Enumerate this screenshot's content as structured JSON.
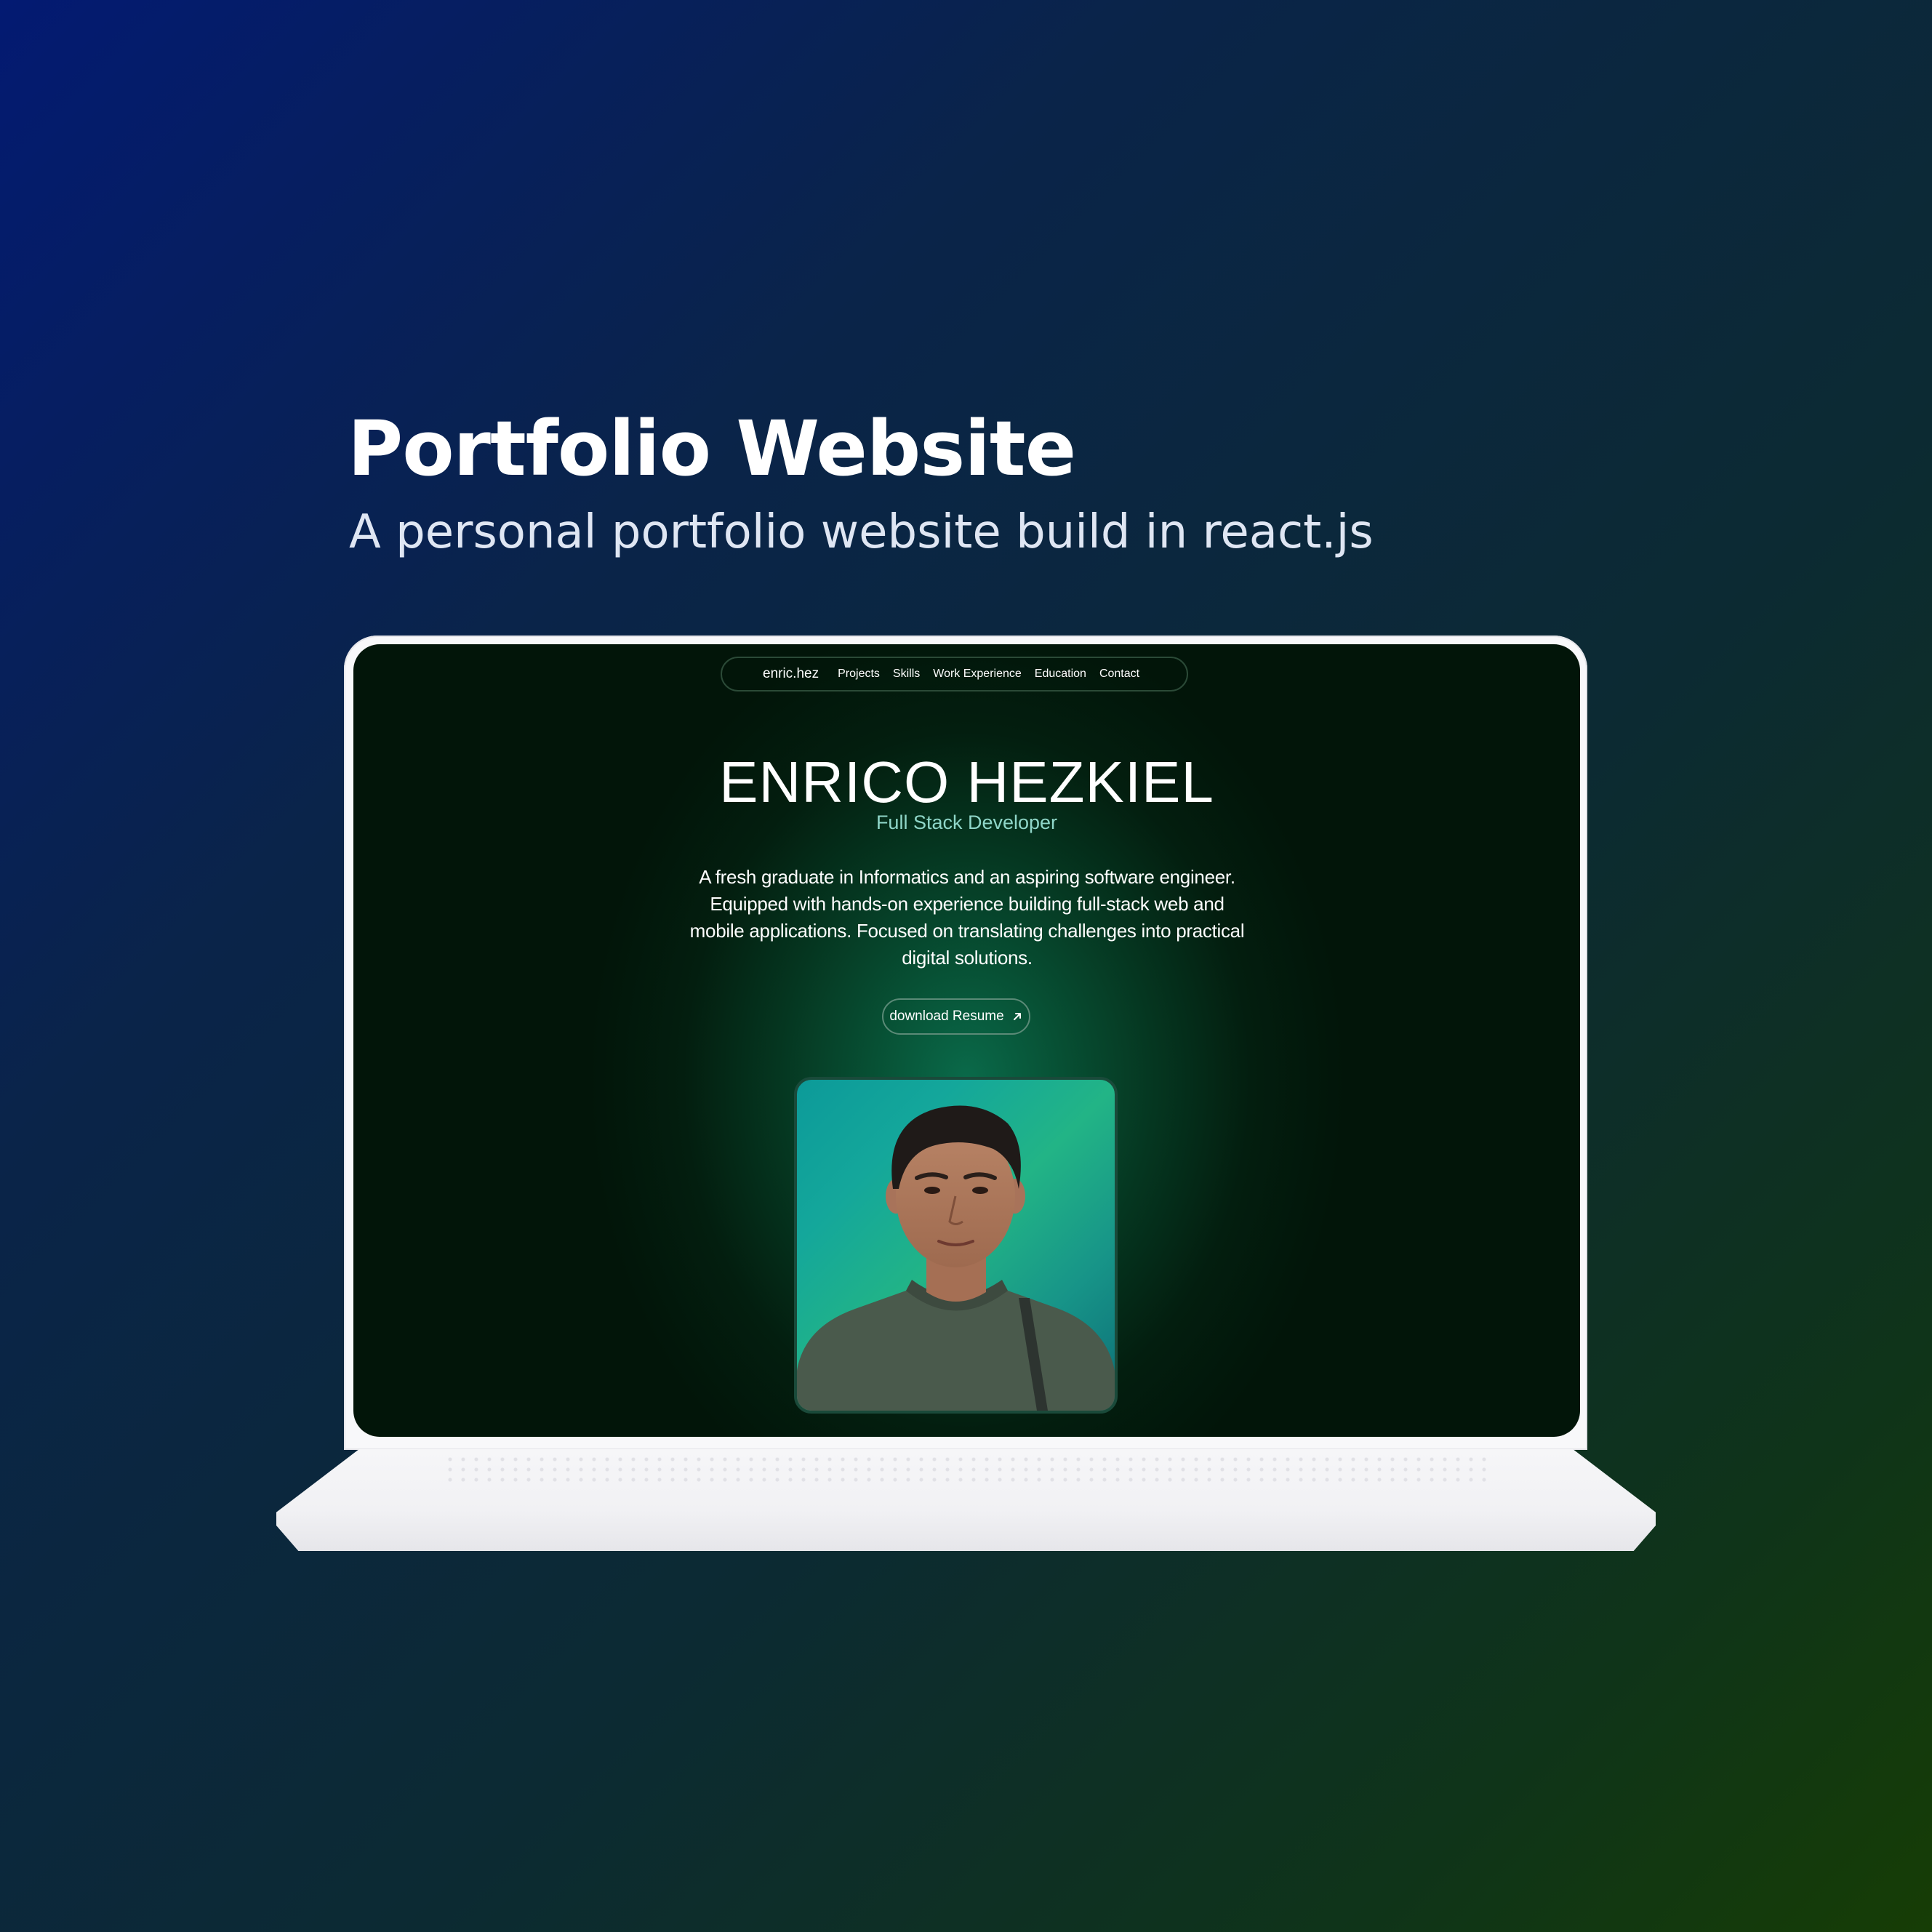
{
  "header": {
    "title": "Portfolio Website",
    "subtitle": "A personal portfolio website build in react.js"
  },
  "site": {
    "nav": {
      "brand": "enric.hez",
      "links": [
        "Projects",
        "Skills",
        "Work Experience",
        "Education",
        "Contact"
      ]
    },
    "name": "ENRICO HEZKIEL",
    "role": "Full Stack Developer",
    "bio": "A fresh graduate in Informatics and an aspiring software engineer. Equipped with hands-on experience building full-stack web and mobile applications. Focused on translating challenges into practical digital solutions.",
    "resume_button": "download Resume",
    "resume_icon": "arrow-up-right-icon",
    "photo": "profile-photo"
  },
  "colors": {
    "page_gradient_start": "#031a72",
    "page_gradient_end": "#163d05",
    "screen_background": "#021509",
    "screen_glow": "#0a6a4a",
    "role_text": "#8fd6c8",
    "laptop_body": "#f8f8fa"
  }
}
